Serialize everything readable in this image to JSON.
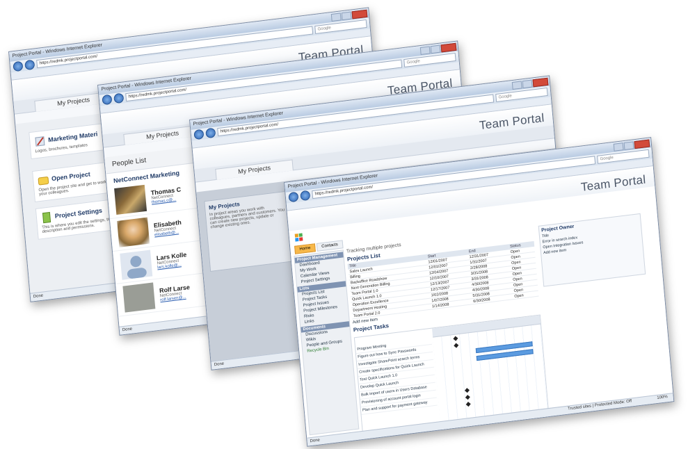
{
  "browser": {
    "window_title": "Project Portal - Windows Internet Explorer",
    "url": "https://redmk.projectportal.com/",
    "search_placeholder": "Google",
    "status_done": "Done"
  },
  "portal": {
    "brand": "Team Portal",
    "tab_my_projects": "My Projects"
  },
  "window1": {
    "cards": [
      {
        "title": "Marketing Materi",
        "desc": "Logos, brochures, templates"
      },
      {
        "title": "Open Project",
        "desc": "Open the project site and get to work with your colleagues."
      },
      {
        "title": "Project Settings",
        "desc": "This is where you edit the settings, title, description and permissions."
      }
    ]
  },
  "window2": {
    "list_title": "People List",
    "group": "NetConnect Marketing",
    "people": [
      {
        "name": "Thomas C",
        "meta": "NetConnect",
        "link": "thomas.c@..."
      },
      {
        "name": "Elisabeth",
        "meta": "NetConnect",
        "link": "elisabeth@..."
      },
      {
        "name": "Lars Kolle",
        "meta": "NetConnect",
        "link": "lars.kolle@..."
      },
      {
        "name": "Rolf Larse",
        "meta": "NetConnect",
        "link": "rolf.larsen@..."
      }
    ]
  },
  "window3": {
    "box_title": "My Projects",
    "box_desc": "In project areas you work with colleagues, partners and customers. You can create new projects, update or change existing ones."
  },
  "window4": {
    "tabs": [
      "Home",
      "Contacts"
    ],
    "page_title": "Tracking multiple projects",
    "projects_heading": "Projects List",
    "columns": [
      "Title",
      "Start",
      "End",
      "Status"
    ],
    "projects": [
      [
        "Sales Launch",
        "12/01/2007",
        "12/31/2007",
        "Open"
      ],
      [
        "Billing",
        "12/01/2007",
        "1/31/2007",
        "Open"
      ],
      [
        "Backoffice Roadshow",
        "12/04/2007",
        "2/28/2008",
        "Open"
      ],
      [
        "Next Generation Billing",
        "12/10/2007",
        "3/31/2008",
        "Open"
      ],
      [
        "Team Portal 1.0",
        "12/13/2007",
        "3/31/2008",
        "Open"
      ],
      [
        "Quick Launch 1.0",
        "12/17/2007",
        "4/30/2008",
        "Open"
      ],
      [
        "Operation Excellence",
        "1/02/2008",
        "4/30/2008",
        "Open"
      ],
      [
        "Department Hosting",
        "1/07/2008",
        "5/31/2008",
        "Open"
      ],
      [
        "Team Portal 2.0",
        "1/14/2008",
        "6/30/2008",
        "Open"
      ]
    ],
    "add_new": "Add new item",
    "tasks_heading": "Project Tasks",
    "tasks": [
      "Program Meeting",
      "Figure out how to Sync Passwords",
      "Investigate SharePoint search terms",
      "Create specifications for Quick Launch",
      "Test Quick Launch 1.0",
      "Develop Quick Launch",
      "Bulk import of users in Users Database",
      "Provisioning of account portal login",
      "Plan and support for payment gateway"
    ],
    "leftnav": {
      "sections": [
        {
          "head": "Project Management",
          "items": [
            "Dashboard",
            "My Work",
            "Calendar Views",
            "Project Settings"
          ]
        },
        {
          "head": "Lists",
          "items": [
            "Projects List",
            "Project Tasks",
            "Project Issues",
            "Project Milestones",
            "Risks",
            "Links"
          ]
        },
        {
          "head": "Documents",
          "items": [
            "Discussions",
            "Wikis",
            "People and Groups"
          ]
        }
      ],
      "recycle": "Recycle Bin"
    },
    "owner_panel": {
      "title": "Project Owner",
      "rows": [
        "Title",
        "Error in search index",
        "Open Integration Issues",
        "Add new item"
      ]
    },
    "status_protected": "Trusted sites | Protected Mode: Off",
    "zoom": "100%"
  },
  "colors": {
    "accent_orange": "#f4a92a",
    "link_blue": "#2a5db0",
    "frame": "#7a8aa3"
  }
}
